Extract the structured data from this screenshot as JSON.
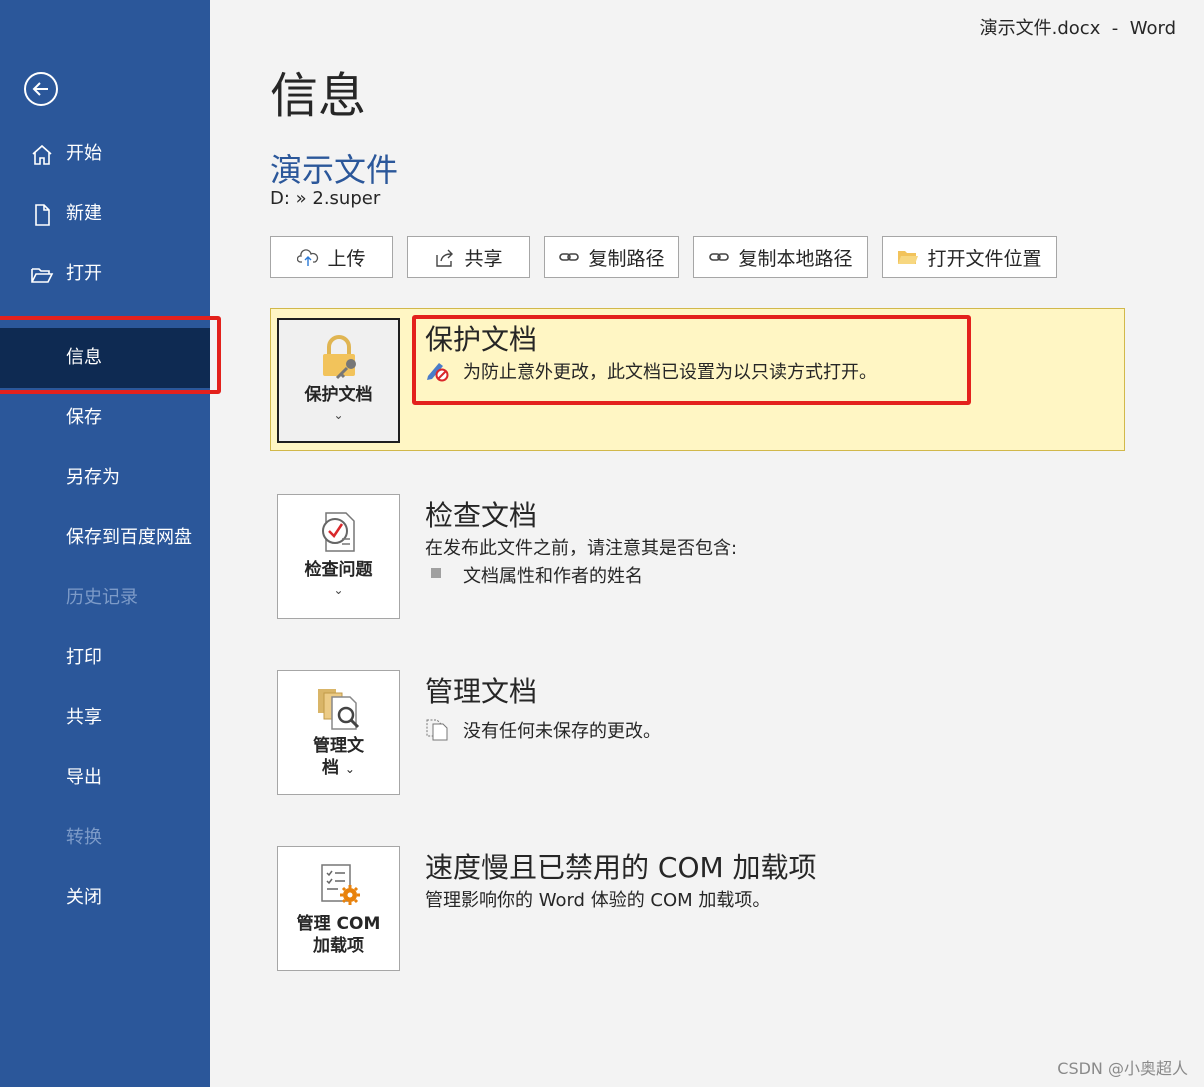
{
  "window": {
    "title": "演示文件.docx  -  Word"
  },
  "sidebar": {
    "back_icon": "back-arrow-icon",
    "items": [
      {
        "label": "开始",
        "icon": "home-icon",
        "state": "normal"
      },
      {
        "label": "新建",
        "icon": "new-document-icon",
        "state": "normal"
      },
      {
        "label": "打开",
        "icon": "open-folder-icon",
        "state": "normal"
      },
      {
        "label": "信息",
        "icon": "",
        "state": "selected"
      },
      {
        "label": "保存",
        "icon": "",
        "state": "normal"
      },
      {
        "label": "另存为",
        "icon": "",
        "state": "normal"
      },
      {
        "label": "保存到百度网盘",
        "icon": "",
        "state": "normal"
      },
      {
        "label": "历史记录",
        "icon": "",
        "state": "disabled"
      },
      {
        "label": "打印",
        "icon": "",
        "state": "normal"
      },
      {
        "label": "共享",
        "icon": "",
        "state": "normal"
      },
      {
        "label": "导出",
        "icon": "",
        "state": "normal"
      },
      {
        "label": "转换",
        "icon": "",
        "state": "disabled"
      },
      {
        "label": "关闭",
        "icon": "",
        "state": "normal"
      }
    ]
  },
  "main": {
    "heading": "信息",
    "doc_title": "演示文件",
    "doc_path": "D: » 2.super",
    "toolbar": [
      {
        "label": "上传",
        "icon": "cloud-upload-icon"
      },
      {
        "label": "共享",
        "icon": "share-icon"
      },
      {
        "label": "复制路径",
        "icon": "link-icon"
      },
      {
        "label": "复制本地路径",
        "icon": "link-icon"
      },
      {
        "label": "打开文件位置",
        "icon": "folder-icon"
      }
    ],
    "sections": {
      "protect": {
        "button_label": "保护文档",
        "button_icon": "lock-key-icon",
        "title": "保护文档",
        "desc": "为防止意外更改，此文档已设置为以只读方式打开。",
        "desc_icon": "no-edit-icon"
      },
      "inspect": {
        "button_label": "检查问题",
        "button_icon": "inspect-checklist-icon",
        "title": "检查文档",
        "desc": "在发布此文件之前，请注意其是否包含:",
        "bullet": "文档属性和作者的姓名"
      },
      "manage": {
        "button_label_line1": "管理文",
        "button_label_line2": "档",
        "button_icon": "manage-document-icon",
        "title": "管理文档",
        "desc": "没有任何未保存的更改。",
        "desc_icon": "documents-icon"
      },
      "com": {
        "button_label_line1": "管理 COM",
        "button_label_line2": "加载项",
        "button_icon": "com-addins-gear-icon",
        "title": "速度慢且已禁用的 COM 加载项",
        "desc": "管理影响你的 Word 体验的 COM 加载项。"
      }
    }
  },
  "watermark": "CSDN @小奥超人",
  "colors": {
    "sidebar": "#2b579a",
    "selected": "#0e2a52",
    "accent": "#2b579a",
    "highlight": "#e3211c",
    "protect_bg": "#fff6c4"
  }
}
